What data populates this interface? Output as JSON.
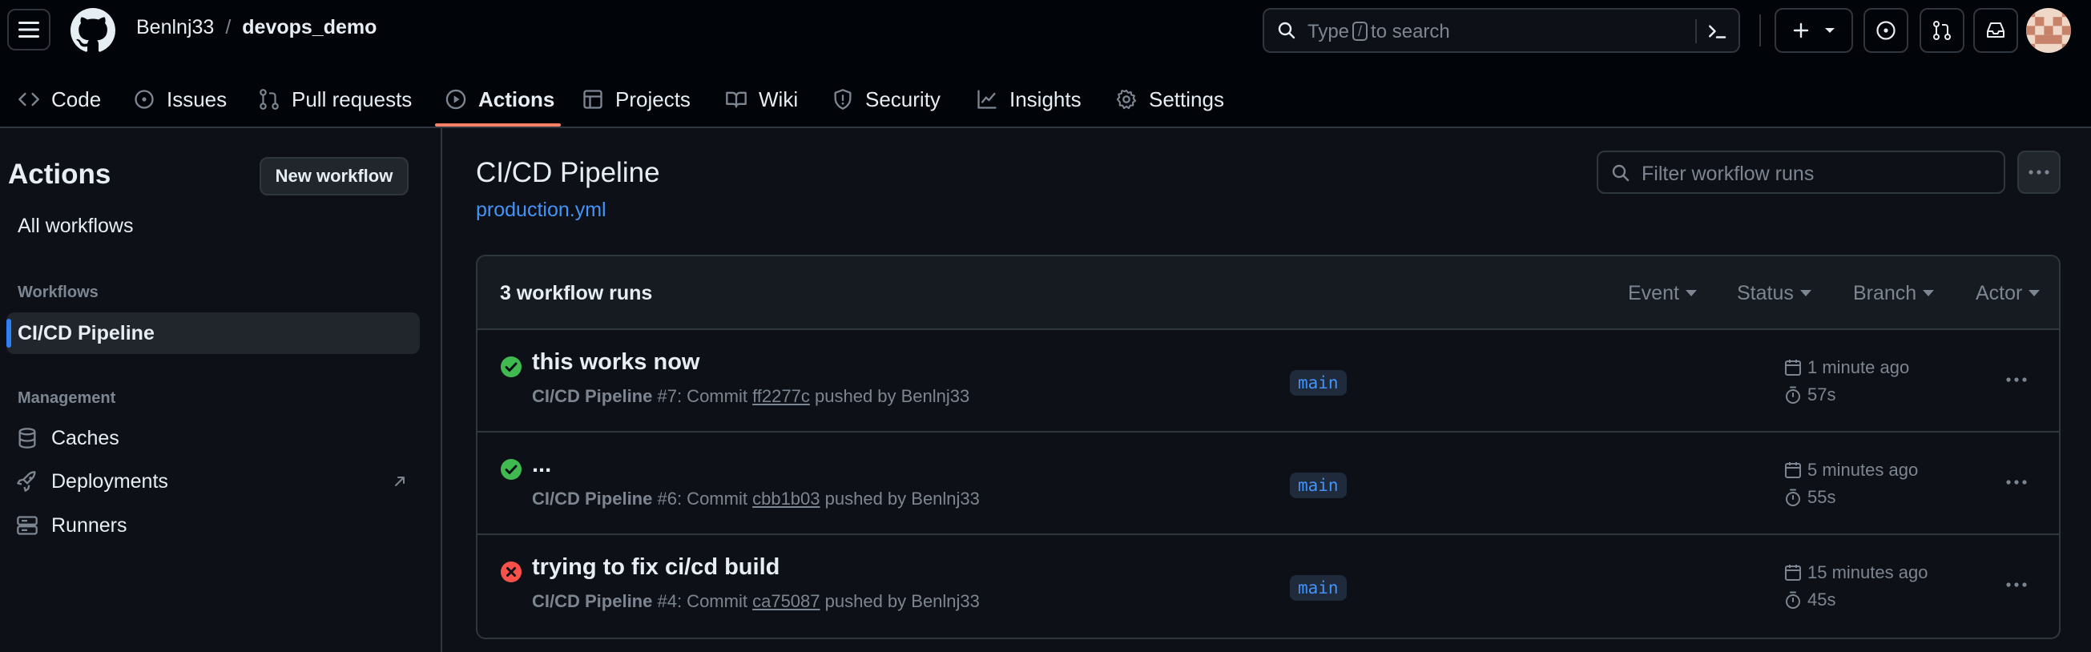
{
  "header": {
    "owner": "Benlnj33",
    "separator": "/",
    "repo": "devops_demo",
    "search_pre": "Type",
    "search_key": "/",
    "search_post": "to search"
  },
  "repo_nav": [
    {
      "label": "Code",
      "icon": "code-icon"
    },
    {
      "label": "Issues",
      "icon": "issue-icon"
    },
    {
      "label": "Pull requests",
      "icon": "pull-request-icon"
    },
    {
      "label": "Actions",
      "icon": "play-icon",
      "active": true
    },
    {
      "label": "Projects",
      "icon": "table-icon"
    },
    {
      "label": "Wiki",
      "icon": "book-icon"
    },
    {
      "label": "Security",
      "icon": "shield-icon"
    },
    {
      "label": "Insights",
      "icon": "graph-icon"
    },
    {
      "label": "Settings",
      "icon": "gear-icon"
    }
  ],
  "sidebar": {
    "title": "Actions",
    "new_workflow": "New workflow",
    "all_workflows": "All workflows",
    "workflows_heading": "Workflows",
    "selected_workflow": "CI/CD Pipeline",
    "management_heading": "Management",
    "management": [
      {
        "label": "Caches",
        "icon": "database-icon"
      },
      {
        "label": "Deployments",
        "icon": "rocket-icon"
      },
      {
        "label": "Runners",
        "icon": "server-icon"
      }
    ]
  },
  "main": {
    "title": "CI/CD Pipeline",
    "file": "production.yml",
    "filter_placeholder": "Filter workflow runs",
    "count": "3 workflow runs",
    "filters": [
      "Event",
      "Status",
      "Branch",
      "Actor"
    ]
  },
  "runs": [
    {
      "status": "success",
      "title": "this works now",
      "workflow": "CI/CD Pipeline",
      "run": "#7: Commit",
      "sha": "ff2277c",
      "pushed": "pushed by Benlnj33",
      "branch": "main",
      "ago": "1 minute ago",
      "duration": "57s"
    },
    {
      "status": "success",
      "title": "...",
      "workflow": "CI/CD Pipeline",
      "run": "#6: Commit",
      "sha": "cbb1b03",
      "pushed": "pushed by Benlnj33",
      "branch": "main",
      "ago": "5 minutes ago",
      "duration": "55s"
    },
    {
      "status": "failure",
      "title": "trying to fix ci/cd build",
      "workflow": "CI/CD Pipeline",
      "run": "#4: Commit",
      "sha": "ca75087",
      "pushed": "pushed by Benlnj33",
      "branch": "main",
      "ago": "15 minutes ago",
      "duration": "45s"
    }
  ],
  "colors": {
    "success": "#3fb950",
    "failure": "#f85149",
    "accent": "#4493f8",
    "tab_underline": "#f78166"
  }
}
